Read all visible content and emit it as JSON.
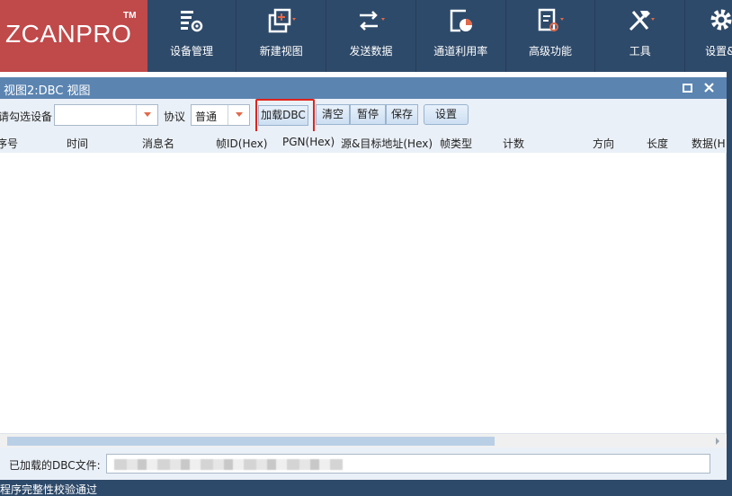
{
  "brand": {
    "name": "ZCANPRO",
    "tm": "TM"
  },
  "ribbon": {
    "tools": [
      {
        "label": "设备管理",
        "icon": "device-manage-icon"
      },
      {
        "label": "新建视图",
        "icon": "new-view-icon"
      },
      {
        "label": "发送数据",
        "icon": "send-data-icon"
      },
      {
        "label": "通道利用率",
        "icon": "channel-usage-icon"
      },
      {
        "label": "高级功能",
        "icon": "advanced-icon"
      },
      {
        "label": "工具",
        "icon": "tools-icon"
      },
      {
        "label": "设置&",
        "icon": "settings-icon"
      }
    ]
  },
  "window": {
    "title": "视图2:DBC 视图"
  },
  "toolbar": {
    "device_label": "请勾选设备",
    "device_value": "",
    "protocol_label": "协议",
    "protocol_value": "普通",
    "load_dbc": "加载DBC",
    "clear": "清空",
    "pause": "暂停",
    "save": "保存",
    "settings": "设置"
  },
  "columns": [
    "序号",
    "时间",
    "消息名",
    "帧ID(Hex)",
    "PGN(Hex)",
    "源&目标地址(Hex)",
    "帧类型",
    "计数",
    "方向",
    "长度",
    "数据(H"
  ],
  "dbc": {
    "loaded_label": "已加载的DBC文件:",
    "path": ""
  },
  "status": {
    "text": "程序完整性校验通过"
  },
  "colors": {
    "ribbon": "#2e4a6a",
    "logo": "#c0494a",
    "title_bar": "#5b84b1",
    "accent": "#e06a4a",
    "highlight": "#e0231c"
  }
}
